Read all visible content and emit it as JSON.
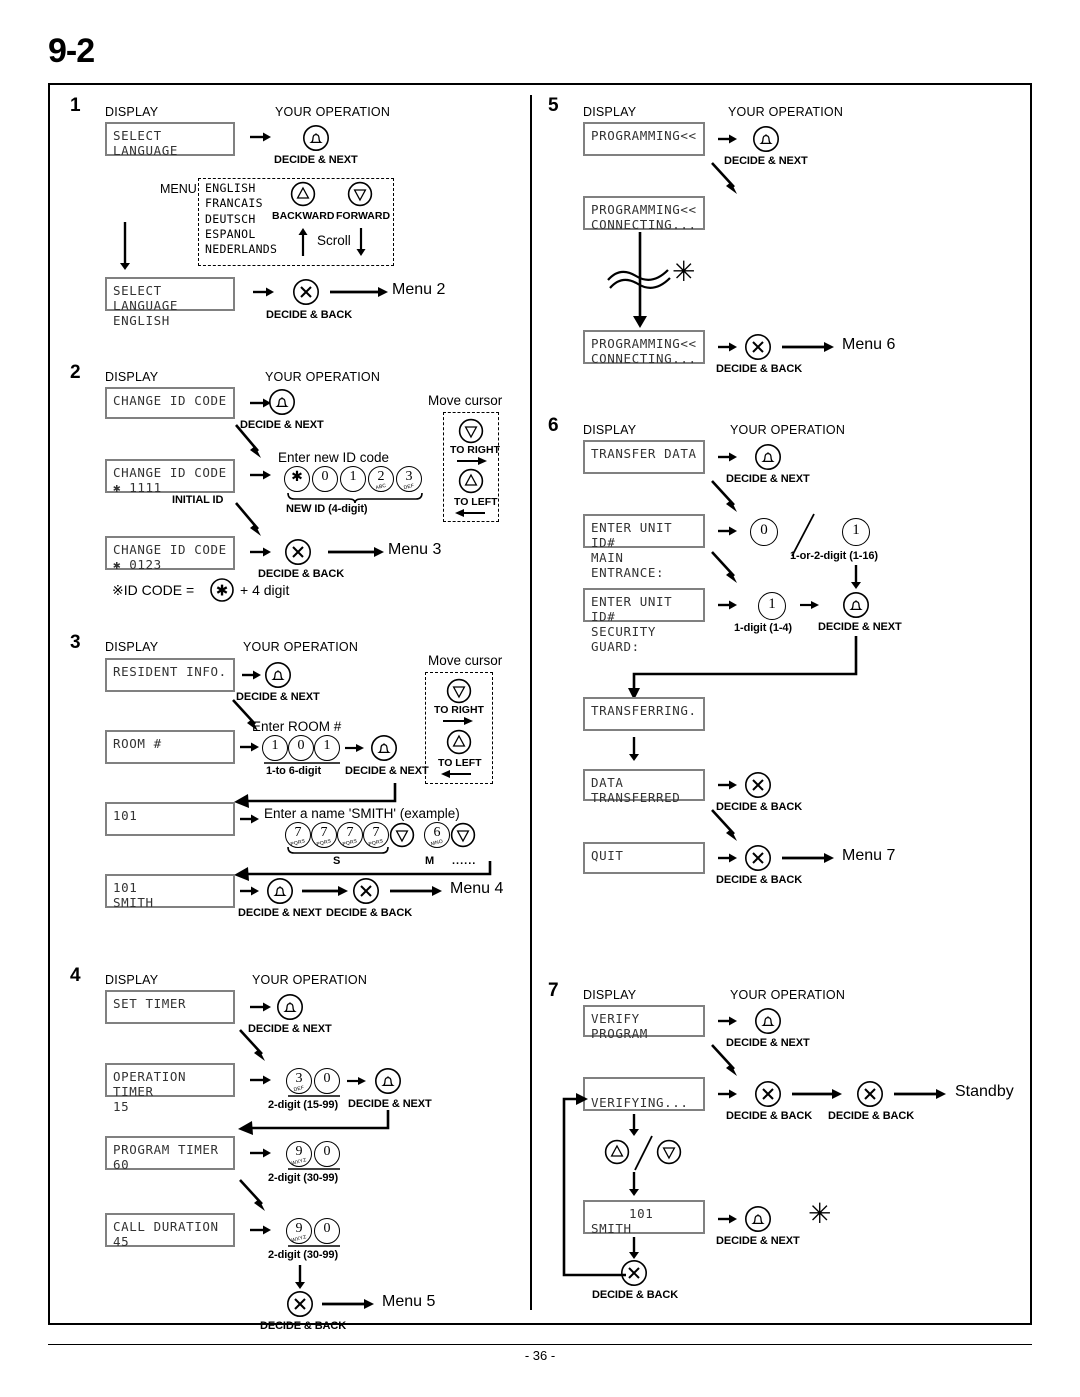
{
  "page": {
    "section_number": "9-2",
    "page_footer": "- 36 -",
    "col_header_display": "DISPLAY",
    "col_header_operation": "YOUR OPERATION",
    "label_decide_next": "DECIDE & NEXT",
    "label_decide_back": "DECIDE & BACK"
  },
  "step1": {
    "number": "1",
    "display1": "SELECT LANGUAGE",
    "menu_label": "MENU",
    "menu_options": [
      "ENGLISH",
      "FRANCAIS",
      "DEUTSCH",
      "ESPANOL",
      "NEDERLANDS"
    ],
    "backward_label": "BACKWARD",
    "forward_label": "FORWARD",
    "scroll_label": "Scroll",
    "display2_line1": "SELECT LANGUAGE",
    "display2_line2": "ENGLISH",
    "next_menu": "Menu 2"
  },
  "step2": {
    "number": "2",
    "display1": "CHANGE ID CODE",
    "display2_line1": "CHANGE ID CODE",
    "display2_line2": "✱ 1111",
    "initial_id_label": "INITIAL ID",
    "enter_label": "Enter new ID code",
    "keys": [
      "✱",
      "0",
      "1",
      "2",
      "3"
    ],
    "key_subs": [
      "",
      "",
      "",
      "ABC",
      "DEF"
    ],
    "brace_label": "NEW ID (4-digit)",
    "move_cursor_label": "Move cursor",
    "to_right_label": "TO RIGHT",
    "to_left_label": "TO LEFT",
    "display3_line1": "CHANGE ID CODE",
    "display3_line2": "✱ 0123",
    "next_menu": "Menu 3",
    "note": "※ID CODE =  + 4 digit",
    "note_pre": "※ID CODE =",
    "note_post": "+ 4 digit"
  },
  "step3": {
    "number": "3",
    "display1": "RESIDENT INFO.",
    "display2": "ROOM #",
    "enter_room_label": "Enter ROOM #",
    "room_keys": [
      "1",
      "0",
      "1"
    ],
    "room_brace_label": "1-to 6-digit",
    "move_cursor_label": "Move cursor",
    "to_right_label": "TO RIGHT",
    "to_left_label": "TO LEFT",
    "display3": "101",
    "enter_name_label": "Enter a name 'SMITH' (example)",
    "name_keys": [
      "7",
      "7",
      "7",
      "7",
      "▽",
      "6",
      "▽"
    ],
    "name_key_subs": [
      "PQRS",
      "PQRS",
      "PQRS",
      "PQRS",
      "",
      "MNO",
      ""
    ],
    "letter_s": "S",
    "letter_m": "M",
    "ellipsis": "......",
    "display4_line1": "101",
    "display4_line2": "SMITH",
    "next_menu": "Menu 4"
  },
  "step4": {
    "number": "4",
    "display1": "SET TIMER",
    "display2_line1": "OPERATION TIMER",
    "display2_line2": "15",
    "op_keys": [
      "3",
      "0"
    ],
    "op_key_subs": [
      "DEF",
      ""
    ],
    "op_brace_label": "2-digit (15-99)",
    "display3_line1": "PROGRAM TIMER",
    "display3_line2": "60",
    "prog_keys": [
      "9",
      "0"
    ],
    "prog_key_subs": [
      "WXYZ",
      ""
    ],
    "prog_brace_label": "2-digit (30-99)",
    "display4_line1": "CALL DURATION",
    "display4_line2": "45",
    "call_keys": [
      "9",
      "0"
    ],
    "call_key_subs": [
      "WXYZ",
      ""
    ],
    "call_brace_label": "2-digit (30-99)",
    "next_menu": "Menu 5"
  },
  "step5": {
    "number": "5",
    "display1": "PROGRAMMING<<",
    "display2_line1": "PROGRAMMING<<",
    "display2_line2": "CONNECTING...",
    "display3_line1": "PROGRAMMING<<",
    "display3_line2": "CONNECTING...",
    "next_menu": "Menu 6",
    "asterisk": "✳"
  },
  "step6": {
    "number": "6",
    "display1": "TRANSFER DATA",
    "display2_line1": "ENTER UNIT ID#",
    "display2_line2": "MAIN ENTRANCE:",
    "unit_keys": [
      "0",
      "1"
    ],
    "unit_label": "1-or-2-digit (1-16)",
    "display3_line1": "ENTER UNIT ID#",
    "display3_line2": "SECURITY GUARD:",
    "guard_key": "1",
    "guard_label": "1-digit (1-4)",
    "display4": "TRANSFERRING.",
    "display5": "DATA TRANSFERRED",
    "display6": "QUIT",
    "next_menu": "Menu 7"
  },
  "step7": {
    "number": "7",
    "display1": "VERIFY PROGRAM",
    "display2": "VERIFYING...",
    "standby_label": "Standby",
    "display3_line1": "101",
    "display3_line2": "SMITH",
    "asterisk": "✳"
  }
}
